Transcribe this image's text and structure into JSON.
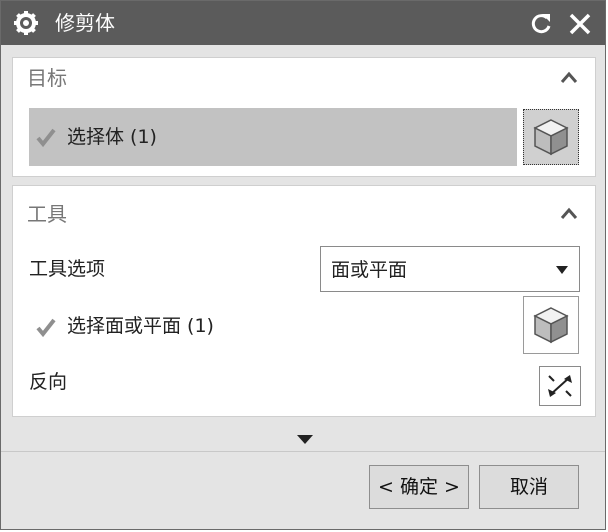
{
  "window": {
    "title": "修剪体"
  },
  "target_group": {
    "title": "目标",
    "select_body_label": "选择体 (1)"
  },
  "tool_group": {
    "title": "工具",
    "tool_option_label": "工具选项",
    "tool_option_value": "面或平面",
    "select_face_label": "选择面或平面 (1)",
    "reverse_label": "反向"
  },
  "footer": {
    "ok_label": "< 确定 >",
    "cancel_label": "取消"
  },
  "icons": {
    "title_left": "gear-icon",
    "title_reset": "reset-icon",
    "title_close": "close-icon",
    "section_collapse": "chevron-up-icon",
    "check": "check-icon",
    "select_body": "cube-icon",
    "select_face": "cube-icon",
    "reverse": "reverse-direction-icon",
    "more": "chevron-down-icon"
  },
  "colors": {
    "titlebar": "#5b5b5b",
    "selected_row": "#c2c2c2",
    "dialog_bg": "#e4e4e4"
  }
}
